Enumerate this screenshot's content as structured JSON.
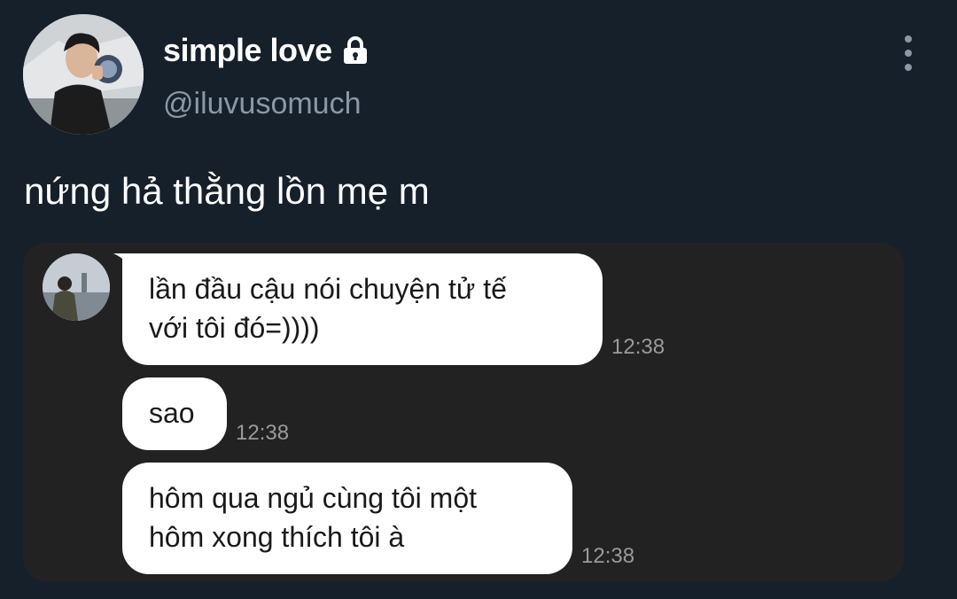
{
  "profile": {
    "display_name": "simple love",
    "handle": "@iluvusomuch",
    "verified_badge": "lock-icon"
  },
  "tweet": {
    "text": "nứng hả thằng lồn mẹ m"
  },
  "menu": {
    "icon": "more-vertical-icon"
  },
  "chat": {
    "messages": [
      {
        "lines": [
          "lần đầu cậu nói chuyện tử tế",
          "với tôi đó=))))"
        ],
        "time": "12:38"
      },
      {
        "lines": [
          "sao"
        ],
        "time": "12:38"
      },
      {
        "lines": [
          "hôm qua ngủ cùng tôi một",
          "hôm xong thích tôi à"
        ],
        "time": "12:38"
      }
    ]
  },
  "colors": {
    "background": "#15202b",
    "media_background": "#222222",
    "bubble": "#ffffff",
    "muted_text": "#8b98a5"
  }
}
